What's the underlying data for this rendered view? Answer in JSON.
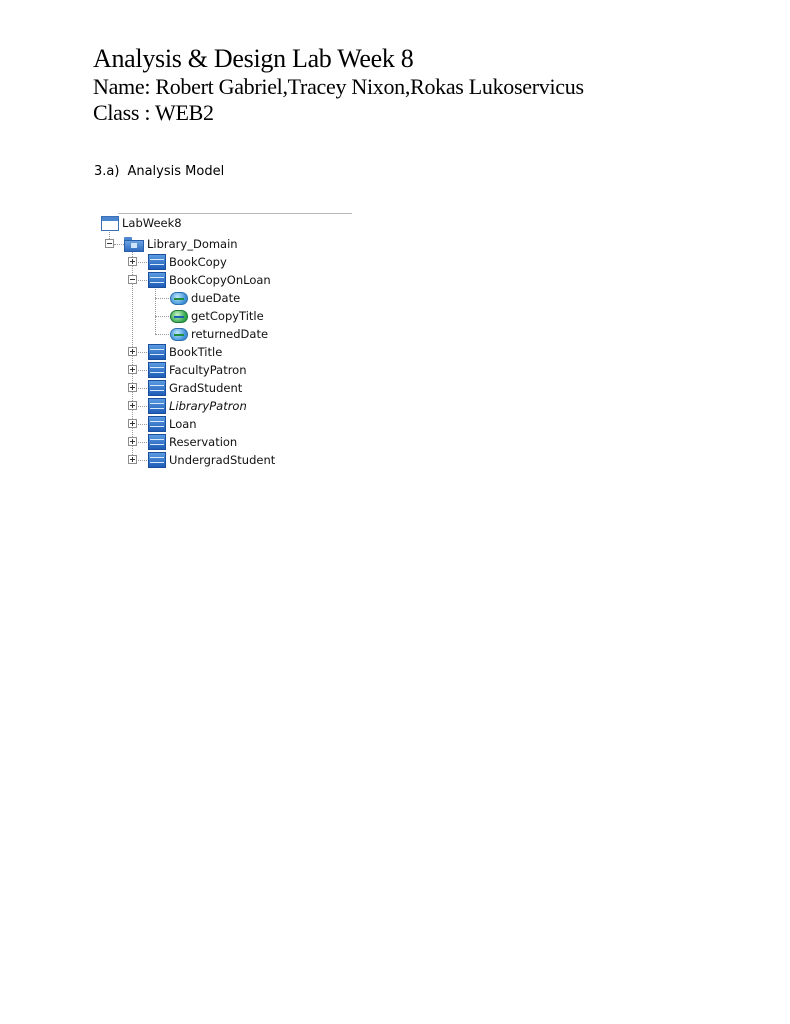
{
  "header": {
    "title": "Analysis & Design Lab Week 8",
    "name_line": "Name: Robert Gabriel,Tracey Nixon,Rokas Lukoservicus",
    "class_line": "Class : WEB2"
  },
  "section": {
    "number": "3.a)",
    "heading": "Analysis Model"
  },
  "tree": {
    "root": {
      "label": "LabWeek8",
      "icon": "project-icon"
    },
    "package": {
      "label": "Library_Domain",
      "icon": "package-icon",
      "expanded": true
    },
    "classes": [
      {
        "label": "BookCopy",
        "icon": "class-icon",
        "expanded": false,
        "italic": false
      },
      {
        "label": "BookCopyOnLoan",
        "icon": "class-icon",
        "expanded": true,
        "italic": false
      },
      {
        "label": "BookTitle",
        "icon": "class-icon",
        "expanded": false,
        "italic": false
      },
      {
        "label": "FacultyPatron",
        "icon": "class-icon",
        "expanded": false,
        "italic": false
      },
      {
        "label": "GradStudent",
        "icon": "class-icon",
        "expanded": false,
        "italic": false
      },
      {
        "label": "LibraryPatron",
        "icon": "class-icon",
        "expanded": false,
        "italic": true
      },
      {
        "label": "Loan",
        "icon": "class-icon",
        "expanded": false,
        "italic": false
      },
      {
        "label": "Reservation",
        "icon": "class-icon",
        "expanded": false,
        "italic": false
      },
      {
        "label": "UndergradStudent",
        "icon": "class-icon",
        "expanded": false,
        "italic": false
      }
    ],
    "members": [
      {
        "label": "dueDate",
        "icon": "attribute-icon"
      },
      {
        "label": "getCopyTitle",
        "icon": "operation-icon"
      },
      {
        "label": "returnedDate",
        "icon": "attribute-icon"
      }
    ]
  },
  "colors": {
    "class_icon": "#2f6cbf",
    "operation_icon": "#2fa44a",
    "attribute_icon": "#3d8fd6"
  }
}
